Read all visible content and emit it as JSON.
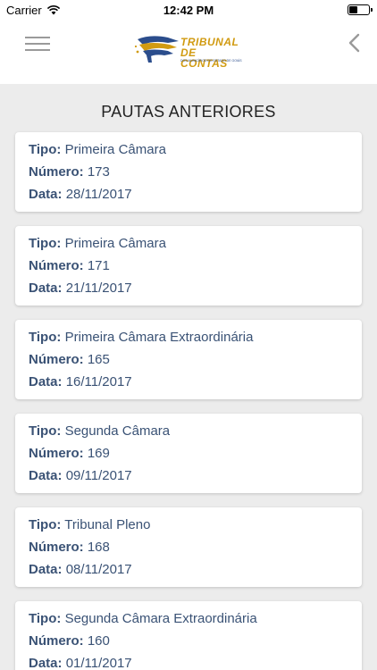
{
  "status_bar": {
    "carrier": "Carrier",
    "time": "12:42 PM"
  },
  "nav": {
    "logo_line1": "TRIBUNAL",
    "logo_line2": "DE CONTAS",
    "logo_sub": "DOS MUNICÍPIOS DO ESTADO DE GOIÁS"
  },
  "page_title": "PAUTAS ANTERIORES",
  "labels": {
    "tipo": "Tipo:",
    "numero": "Número:",
    "data": "Data:"
  },
  "pautas": [
    {
      "tipo": "Primeira Câmara",
      "numero": "173",
      "data": "28/11/2017"
    },
    {
      "tipo": "Primeira Câmara",
      "numero": "171",
      "data": "21/11/2017"
    },
    {
      "tipo": "Primeira Câmara Extraordinária",
      "numero": "165",
      "data": "16/11/2017"
    },
    {
      "tipo": "Segunda Câmara",
      "numero": "169",
      "data": "09/11/2017"
    },
    {
      "tipo": "Tribunal Pleno",
      "numero": "168",
      "data": "08/11/2017"
    },
    {
      "tipo": "Segunda Câmara Extraordinária",
      "numero": "160",
      "data": "01/11/2017"
    }
  ],
  "colors": {
    "label_text": "#3a5275",
    "background": "#ececec",
    "logo_gold": "#d19b12",
    "logo_blue": "#2b4d8c"
  }
}
